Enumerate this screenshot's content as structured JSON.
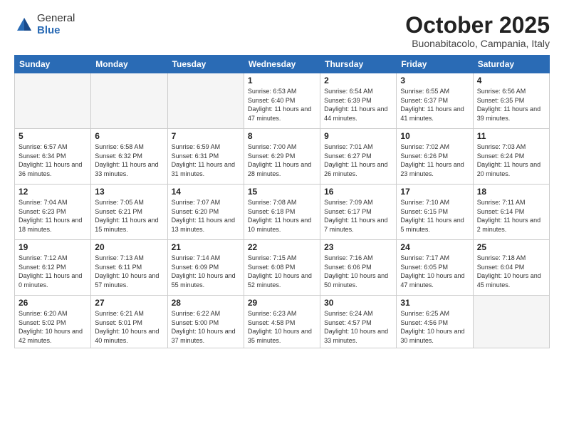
{
  "logo": {
    "general": "General",
    "blue": "Blue"
  },
  "title": "October 2025",
  "location": "Buonabitacolo, Campania, Italy",
  "weekdays": [
    "Sunday",
    "Monday",
    "Tuesday",
    "Wednesday",
    "Thursday",
    "Friday",
    "Saturday"
  ],
  "weeks": [
    [
      {
        "day": "",
        "info": ""
      },
      {
        "day": "",
        "info": ""
      },
      {
        "day": "",
        "info": ""
      },
      {
        "day": "1",
        "info": "Sunrise: 6:53 AM\nSunset: 6:40 PM\nDaylight: 11 hours\nand 47 minutes."
      },
      {
        "day": "2",
        "info": "Sunrise: 6:54 AM\nSunset: 6:39 PM\nDaylight: 11 hours\nand 44 minutes."
      },
      {
        "day": "3",
        "info": "Sunrise: 6:55 AM\nSunset: 6:37 PM\nDaylight: 11 hours\nand 41 minutes."
      },
      {
        "day": "4",
        "info": "Sunrise: 6:56 AM\nSunset: 6:35 PM\nDaylight: 11 hours\nand 39 minutes."
      }
    ],
    [
      {
        "day": "5",
        "info": "Sunrise: 6:57 AM\nSunset: 6:34 PM\nDaylight: 11 hours\nand 36 minutes."
      },
      {
        "day": "6",
        "info": "Sunrise: 6:58 AM\nSunset: 6:32 PM\nDaylight: 11 hours\nand 33 minutes."
      },
      {
        "day": "7",
        "info": "Sunrise: 6:59 AM\nSunset: 6:31 PM\nDaylight: 11 hours\nand 31 minutes."
      },
      {
        "day": "8",
        "info": "Sunrise: 7:00 AM\nSunset: 6:29 PM\nDaylight: 11 hours\nand 28 minutes."
      },
      {
        "day": "9",
        "info": "Sunrise: 7:01 AM\nSunset: 6:27 PM\nDaylight: 11 hours\nand 26 minutes."
      },
      {
        "day": "10",
        "info": "Sunrise: 7:02 AM\nSunset: 6:26 PM\nDaylight: 11 hours\nand 23 minutes."
      },
      {
        "day": "11",
        "info": "Sunrise: 7:03 AM\nSunset: 6:24 PM\nDaylight: 11 hours\nand 20 minutes."
      }
    ],
    [
      {
        "day": "12",
        "info": "Sunrise: 7:04 AM\nSunset: 6:23 PM\nDaylight: 11 hours\nand 18 minutes."
      },
      {
        "day": "13",
        "info": "Sunrise: 7:05 AM\nSunset: 6:21 PM\nDaylight: 11 hours\nand 15 minutes."
      },
      {
        "day": "14",
        "info": "Sunrise: 7:07 AM\nSunset: 6:20 PM\nDaylight: 11 hours\nand 13 minutes."
      },
      {
        "day": "15",
        "info": "Sunrise: 7:08 AM\nSunset: 6:18 PM\nDaylight: 11 hours\nand 10 minutes."
      },
      {
        "day": "16",
        "info": "Sunrise: 7:09 AM\nSunset: 6:17 PM\nDaylight: 11 hours\nand 7 minutes."
      },
      {
        "day": "17",
        "info": "Sunrise: 7:10 AM\nSunset: 6:15 PM\nDaylight: 11 hours\nand 5 minutes."
      },
      {
        "day": "18",
        "info": "Sunrise: 7:11 AM\nSunset: 6:14 PM\nDaylight: 11 hours\nand 2 minutes."
      }
    ],
    [
      {
        "day": "19",
        "info": "Sunrise: 7:12 AM\nSunset: 6:12 PM\nDaylight: 11 hours\nand 0 minutes."
      },
      {
        "day": "20",
        "info": "Sunrise: 7:13 AM\nSunset: 6:11 PM\nDaylight: 10 hours\nand 57 minutes."
      },
      {
        "day": "21",
        "info": "Sunrise: 7:14 AM\nSunset: 6:09 PM\nDaylight: 10 hours\nand 55 minutes."
      },
      {
        "day": "22",
        "info": "Sunrise: 7:15 AM\nSunset: 6:08 PM\nDaylight: 10 hours\nand 52 minutes."
      },
      {
        "day": "23",
        "info": "Sunrise: 7:16 AM\nSunset: 6:06 PM\nDaylight: 10 hours\nand 50 minutes."
      },
      {
        "day": "24",
        "info": "Sunrise: 7:17 AM\nSunset: 6:05 PM\nDaylight: 10 hours\nand 47 minutes."
      },
      {
        "day": "25",
        "info": "Sunrise: 7:18 AM\nSunset: 6:04 PM\nDaylight: 10 hours\nand 45 minutes."
      }
    ],
    [
      {
        "day": "26",
        "info": "Sunrise: 6:20 AM\nSunset: 5:02 PM\nDaylight: 10 hours\nand 42 minutes."
      },
      {
        "day": "27",
        "info": "Sunrise: 6:21 AM\nSunset: 5:01 PM\nDaylight: 10 hours\nand 40 minutes."
      },
      {
        "day": "28",
        "info": "Sunrise: 6:22 AM\nSunset: 5:00 PM\nDaylight: 10 hours\nand 37 minutes."
      },
      {
        "day": "29",
        "info": "Sunrise: 6:23 AM\nSunset: 4:58 PM\nDaylight: 10 hours\nand 35 minutes."
      },
      {
        "day": "30",
        "info": "Sunrise: 6:24 AM\nSunset: 4:57 PM\nDaylight: 10 hours\nand 33 minutes."
      },
      {
        "day": "31",
        "info": "Sunrise: 6:25 AM\nSunset: 4:56 PM\nDaylight: 10 hours\nand 30 minutes."
      },
      {
        "day": "",
        "info": ""
      }
    ]
  ]
}
